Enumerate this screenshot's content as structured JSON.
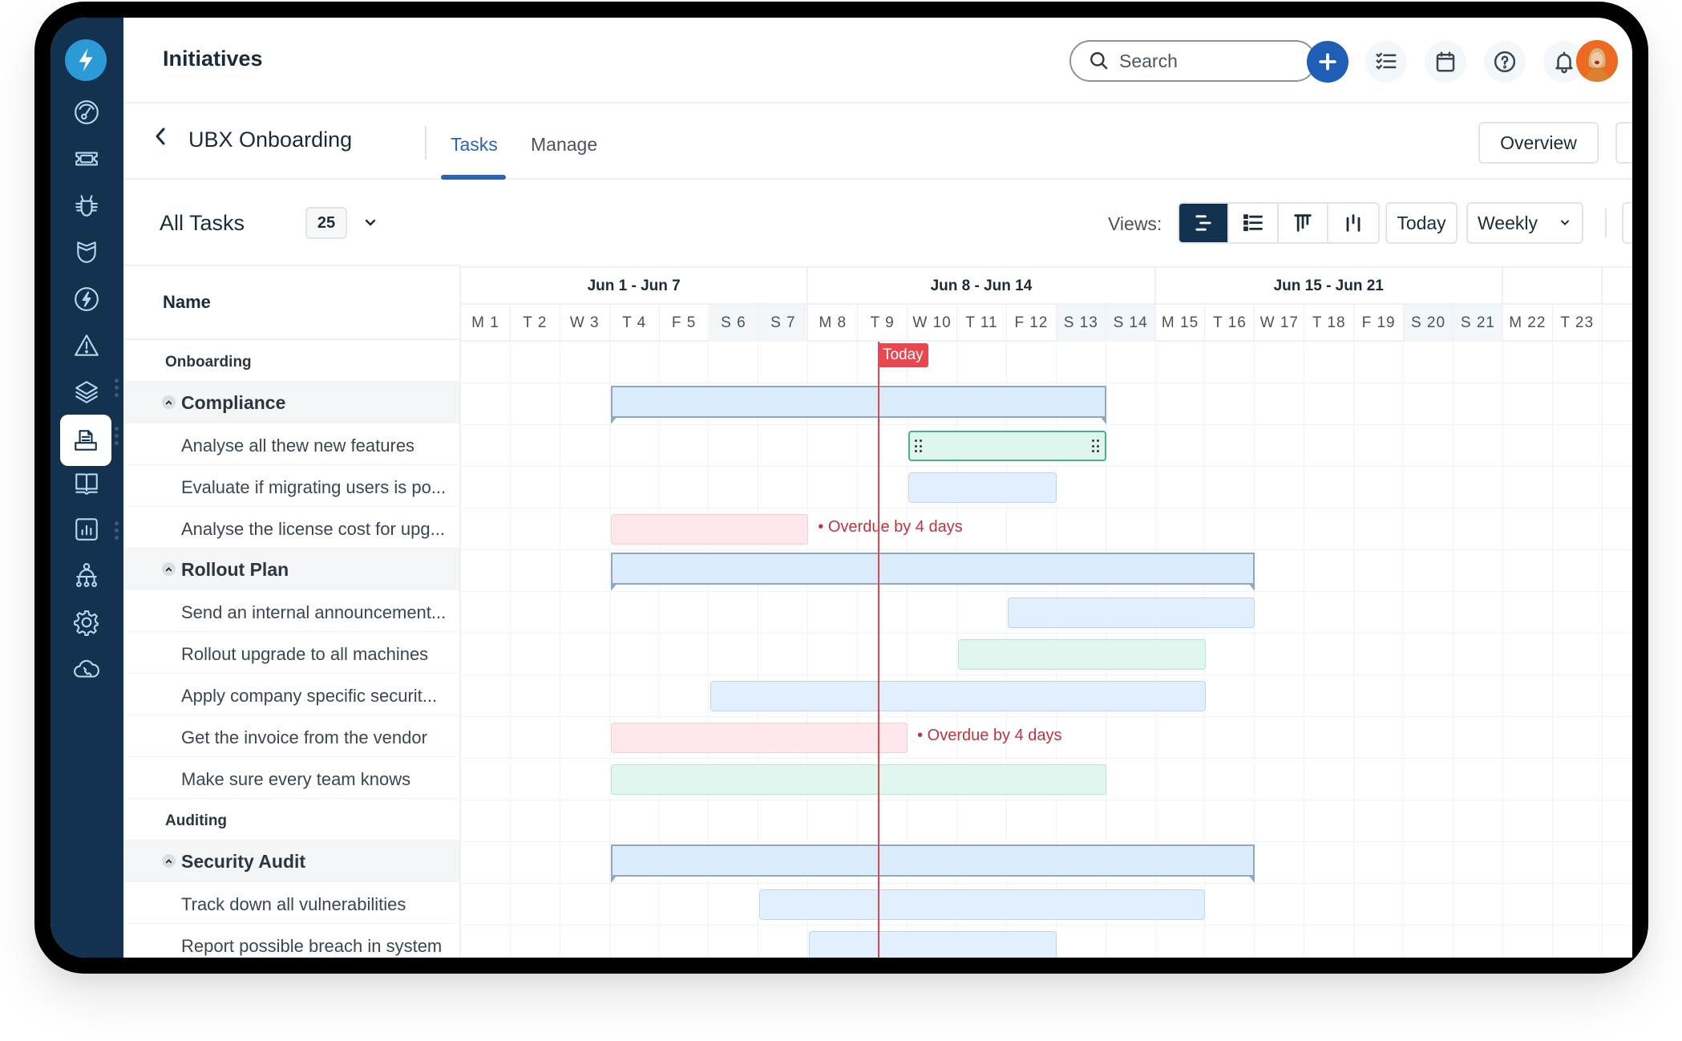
{
  "app": {
    "title": "Initiatives",
    "search_placeholder": "Search"
  },
  "topbar_icons": [
    "add-icon",
    "checklist-icon",
    "calendar-icon",
    "help-icon",
    "bell-icon"
  ],
  "sidebar": {
    "items": [
      {
        "icon": "dashboard-gauge-icon"
      },
      {
        "icon": "ticket-icon"
      },
      {
        "icon": "bug-icon"
      },
      {
        "icon": "shield-icon"
      },
      {
        "icon": "lightning-icon"
      },
      {
        "icon": "alert-triangle-icon"
      },
      {
        "icon": "layers-icon"
      },
      {
        "icon": "document-tray-icon",
        "active": true
      },
      {
        "icon": "book-icon"
      },
      {
        "icon": "bar-chart-icon"
      },
      {
        "icon": "org-chart-icon"
      },
      {
        "icon": "settings-gear-icon"
      },
      {
        "icon": "cloud-phone-icon"
      }
    ]
  },
  "subheader": {
    "back_label": "‹",
    "project_name": "UBX Onboarding",
    "tabs": [
      {
        "label": "Tasks",
        "active": true
      },
      {
        "label": "Manage",
        "active": false
      }
    ],
    "overview_label": "Overview"
  },
  "toolbar": {
    "title": "All Tasks",
    "count": "25",
    "views_label": "Views:",
    "views": [
      "gantt-view",
      "list-view",
      "board-view",
      "column-view"
    ],
    "active_view": "gantt-view",
    "today_label": "Today",
    "scale_label": "Weekly"
  },
  "gantt": {
    "name_header": "Name",
    "weeks": [
      {
        "label": "Jun 1 - Jun 7",
        "start": 0,
        "days": 7
      },
      {
        "label": "Jun 8 - Jun 14",
        "start": 7,
        "days": 7
      },
      {
        "label": "Jun 15 - Jun 21",
        "start": 14,
        "days": 7
      },
      {
        "label": "",
        "start": 21,
        "days": 2
      }
    ],
    "days": [
      {
        "label": "M 1",
        "weekend": false
      },
      {
        "label": "T 2",
        "weekend": false
      },
      {
        "label": "W 3",
        "weekend": false
      },
      {
        "label": "T 4",
        "weekend": false
      },
      {
        "label": "F 5",
        "weekend": false
      },
      {
        "label": "S 6",
        "weekend": true
      },
      {
        "label": "S 7",
        "weekend": true
      },
      {
        "label": "M 8",
        "weekend": false
      },
      {
        "label": "T 9",
        "weekend": false
      },
      {
        "label": "W 10",
        "weekend": false
      },
      {
        "label": "T 11",
        "weekend": false
      },
      {
        "label": "F 12",
        "weekend": false
      },
      {
        "label": "S 13",
        "weekend": true
      },
      {
        "label": "S 14",
        "weekend": true
      },
      {
        "label": "M 15",
        "weekend": false
      },
      {
        "label": "T 16",
        "weekend": false
      },
      {
        "label": "W 17",
        "weekend": false
      },
      {
        "label": "T 18",
        "weekend": false
      },
      {
        "label": "F 19",
        "weekend": false
      },
      {
        "label": "S 20",
        "weekend": true
      },
      {
        "label": "S 21",
        "weekend": true
      },
      {
        "label": "M 22",
        "weekend": false
      },
      {
        "label": "T 23",
        "weekend": false
      }
    ],
    "today": {
      "label": "Today",
      "day": 8.4
    },
    "rows": [
      {
        "type": "section",
        "name": "Onboarding"
      },
      {
        "type": "group",
        "name": "Compliance",
        "bar": {
          "start": 3,
          "end": 12,
          "style": "summary"
        }
      },
      {
        "type": "task",
        "name": "Analyse all thew new features",
        "bar": {
          "start": 9,
          "end": 12,
          "style": "green",
          "selected": true
        }
      },
      {
        "type": "task",
        "name": "Evaluate if migrating users is po...",
        "bar": {
          "start": 9,
          "end": 11,
          "style": "blue"
        }
      },
      {
        "type": "task",
        "name": "Analyse the license cost for upg...",
        "bar": {
          "start": 3,
          "end": 6,
          "style": "red"
        },
        "overdue": "Overdue by 4 days"
      },
      {
        "type": "group",
        "name": "Rollout Plan",
        "bar": {
          "start": 3,
          "end": 15,
          "style": "summary"
        }
      },
      {
        "type": "task",
        "name": "Send an internal announcement...",
        "bar": {
          "start": 11,
          "end": 15,
          "style": "blue"
        }
      },
      {
        "type": "task",
        "name": "Rollout upgrade to all machines",
        "bar": {
          "start": 10,
          "end": 14,
          "style": "green"
        }
      },
      {
        "type": "task",
        "name": "Apply company specific securit...",
        "bar": {
          "start": 5,
          "end": 14,
          "style": "blue"
        }
      },
      {
        "type": "task",
        "name": "Get the invoice from the vendor",
        "bar": {
          "start": 3,
          "end": 8,
          "style": "red"
        },
        "overdue": "Overdue by 4 days"
      },
      {
        "type": "task",
        "name": "Make sure every team knows",
        "bar": {
          "start": 3,
          "end": 12,
          "style": "green"
        }
      },
      {
        "type": "section",
        "name": "Auditing"
      },
      {
        "type": "group",
        "name": "Security Audit",
        "bar": {
          "start": 3,
          "end": 15,
          "style": "summary"
        }
      },
      {
        "type": "task",
        "name": "Track down all vulnerabilities",
        "bar": {
          "start": 6,
          "end": 14,
          "style": "blue"
        }
      },
      {
        "type": "task",
        "name": "Report possible breach in system",
        "bar": {
          "start": 7,
          "end": 11,
          "style": "blue"
        }
      }
    ]
  }
}
